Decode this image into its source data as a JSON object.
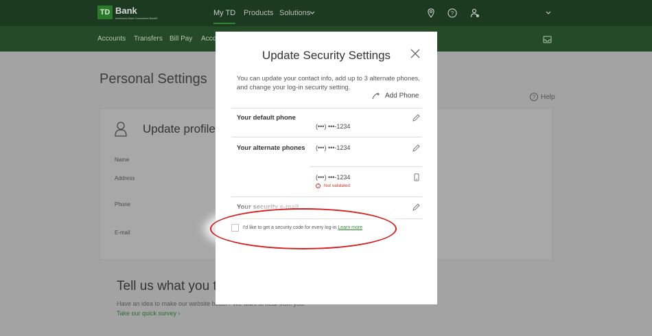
{
  "header": {
    "logo": "TD",
    "bank": "Bank",
    "tagline": "America's Most Convenient Bank®",
    "nav": [
      {
        "label": "My TD"
      },
      {
        "label": "Products"
      },
      {
        "label": "Solutions"
      }
    ],
    "icons": [
      "location-icon",
      "help-icon",
      "user-icon",
      "chevron-down-icon"
    ]
  },
  "subnav": {
    "items": [
      "Accounts",
      "Transfers",
      "Bill Pay",
      "Acco"
    ]
  },
  "background": {
    "title": "Personal Settings",
    "help": "Help",
    "update_profile": "Update profile",
    "labels": [
      "Name",
      "Address",
      "Phone",
      "E-mail"
    ],
    "tell": "Tell us what you t",
    "idea": "Have an idea to make our website better? We want to hear from you!",
    "survey": "Take our quick survey  ›"
  },
  "modal": {
    "title": "Update Security Settings",
    "description": "You can update your contact info, add up to 3 alternate phones, and change your log-in security setting.",
    "add_phone": "Add Phone",
    "default_phone_label": "Your default phone",
    "default_phone": "(•••) •••-1234",
    "alternate_label": "Your alternate phones",
    "alternate_phones": [
      "(•••) •••-1234",
      "(•••) •••-1234"
    ],
    "not_validated": "Not validated",
    "email_label": "Your security e-mail",
    "checkbox_label": "I'd like to get a security code for every log-in",
    "learn_more": "Learn more"
  },
  "colors": {
    "header": "#1b3a1f",
    "subnav": "#244a27",
    "accent_green": "#2a8a2d",
    "warning": "#c0392b",
    "highlight_circle": "#d61f1f"
  }
}
